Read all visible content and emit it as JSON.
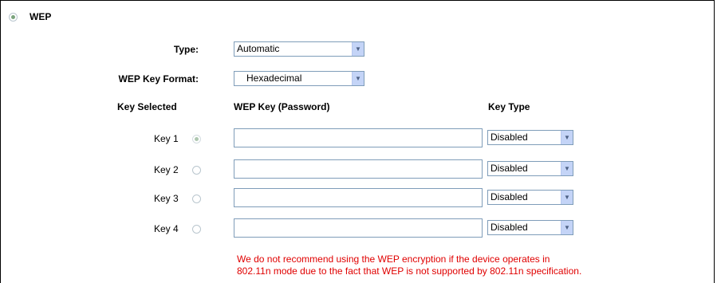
{
  "section": {
    "title": "WEP",
    "selected": true
  },
  "type": {
    "label": "Type:",
    "value": "Automatic"
  },
  "key_format": {
    "label": "WEP Key Format:",
    "value": "Hexadecimal"
  },
  "headers": {
    "key_selected": "Key Selected",
    "wep_key": "WEP Key (Password)",
    "key_type": "Key Type"
  },
  "keys": [
    {
      "label": "Key 1",
      "selected": true,
      "value": "",
      "type": "Disabled"
    },
    {
      "label": "Key 2",
      "selected": false,
      "value": "",
      "type": "Disabled"
    },
    {
      "label": "Key 3",
      "selected": false,
      "value": "",
      "type": "Disabled"
    },
    {
      "label": "Key 4",
      "selected": false,
      "value": "",
      "type": "Disabled"
    }
  ],
  "warning": {
    "line1": "We do not recommend using the WEP encryption if the device operates in",
    "line2": "802.11n mode due to the fact that WEP is not supported by 802.11n specification."
  },
  "colors": {
    "warning": "#e00000",
    "radio_checked": "#7aa37c"
  }
}
